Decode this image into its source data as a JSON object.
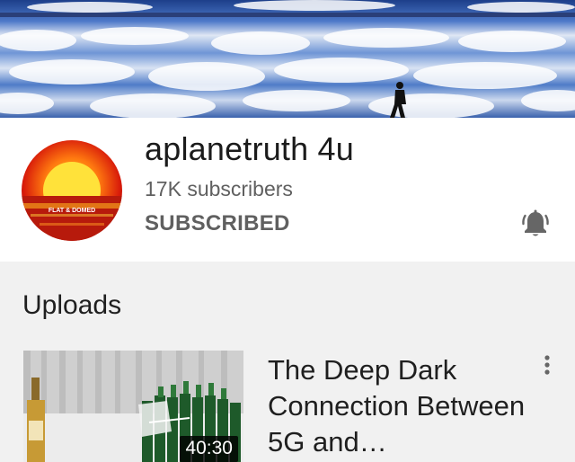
{
  "channel": {
    "name": "aplanetruth 4u",
    "subscribers": "17K subscribers",
    "subscribe_state": "SUBSCRIBED",
    "avatar_text": "FLAT & DOMED"
  },
  "uploads": {
    "label": "Uploads",
    "videos": [
      {
        "title": "The Deep Dark Connection Between 5G and…",
        "duration": "40:30"
      }
    ]
  },
  "colors": {
    "header_bg": "#ffffff",
    "page_bg": "#f1f1f1",
    "secondary_text": "#606060"
  },
  "icons": [
    "notification-bell-icon",
    "more-vert-icon"
  ]
}
